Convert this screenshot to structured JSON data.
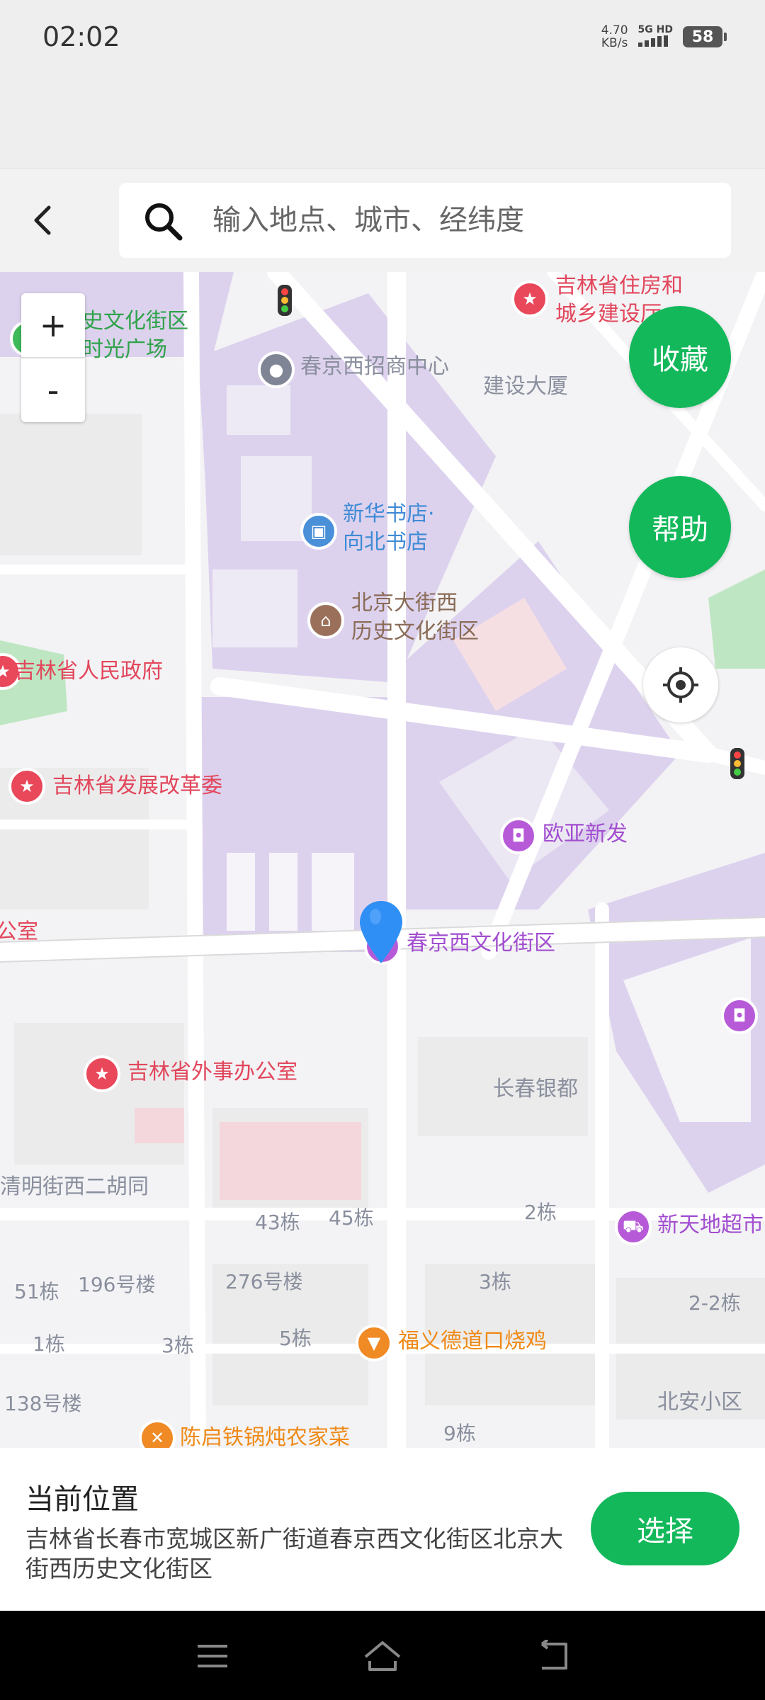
{
  "status_bar": {
    "time": "02:02",
    "speed_value": "4.70",
    "speed_unit": "KB/s",
    "network": "5G HD",
    "battery": "58"
  },
  "search": {
    "placeholder": "输入地点、城市、经纬度"
  },
  "map": {
    "zoom_in_label": "+",
    "zoom_out_label": "-",
    "favorite_label": "收藏",
    "help_label": "帮助",
    "pois": [
      {
        "name": "吉林省住房和",
        "name2": "城乡建设厅"
      },
      {
        "name": "史文化街区",
        "name2": "时光广场"
      },
      {
        "name": "春京西招商中心"
      },
      {
        "name": "建设大厦"
      },
      {
        "name": "新华书店·",
        "name2": "向北书店"
      },
      {
        "name": "北京大街西",
        "name2": "历史文化街区"
      },
      {
        "name": "吉林省人民政府"
      },
      {
        "name": "吉林省发展改革委"
      },
      {
        "name": "欧亚新发"
      },
      {
        "name": "春京西文化街区"
      },
      {
        "name": "公室"
      },
      {
        "name": "吉林省外事办公室"
      },
      {
        "name": "长春银都"
      },
      {
        "name": "清明街西二胡同"
      },
      {
        "name": "43栋"
      },
      {
        "name": "45栋"
      },
      {
        "name": "2栋"
      },
      {
        "name": "新天地超市"
      },
      {
        "name": "51栋"
      },
      {
        "name": "196号楼"
      },
      {
        "name": "276号楼"
      },
      {
        "name": "3栋"
      },
      {
        "name": "2-2栋"
      },
      {
        "name": "1栋"
      },
      {
        "name": "3栋"
      },
      {
        "name": "5栋"
      },
      {
        "name": "福义德道口烧鸡"
      },
      {
        "name": "138号楼"
      },
      {
        "name": "北安小区"
      },
      {
        "name": "陈启铁锅炖农家菜"
      },
      {
        "name": "9栋"
      }
    ]
  },
  "current_location": {
    "title": "当前位置",
    "address": "吉林省长春市宽城区新广街道春京西文化街区北京大街西历史文化街区",
    "select_label": "选择"
  },
  "colors": {
    "accent": "#13b85b",
    "marker": "#2f8ff5",
    "area_purple": "#ddd2ee"
  },
  "icons": [
    "back-arrow-icon",
    "search-icon",
    "locate-icon",
    "location-pin-icon",
    "menu-icon",
    "home-icon",
    "back-icon"
  ]
}
